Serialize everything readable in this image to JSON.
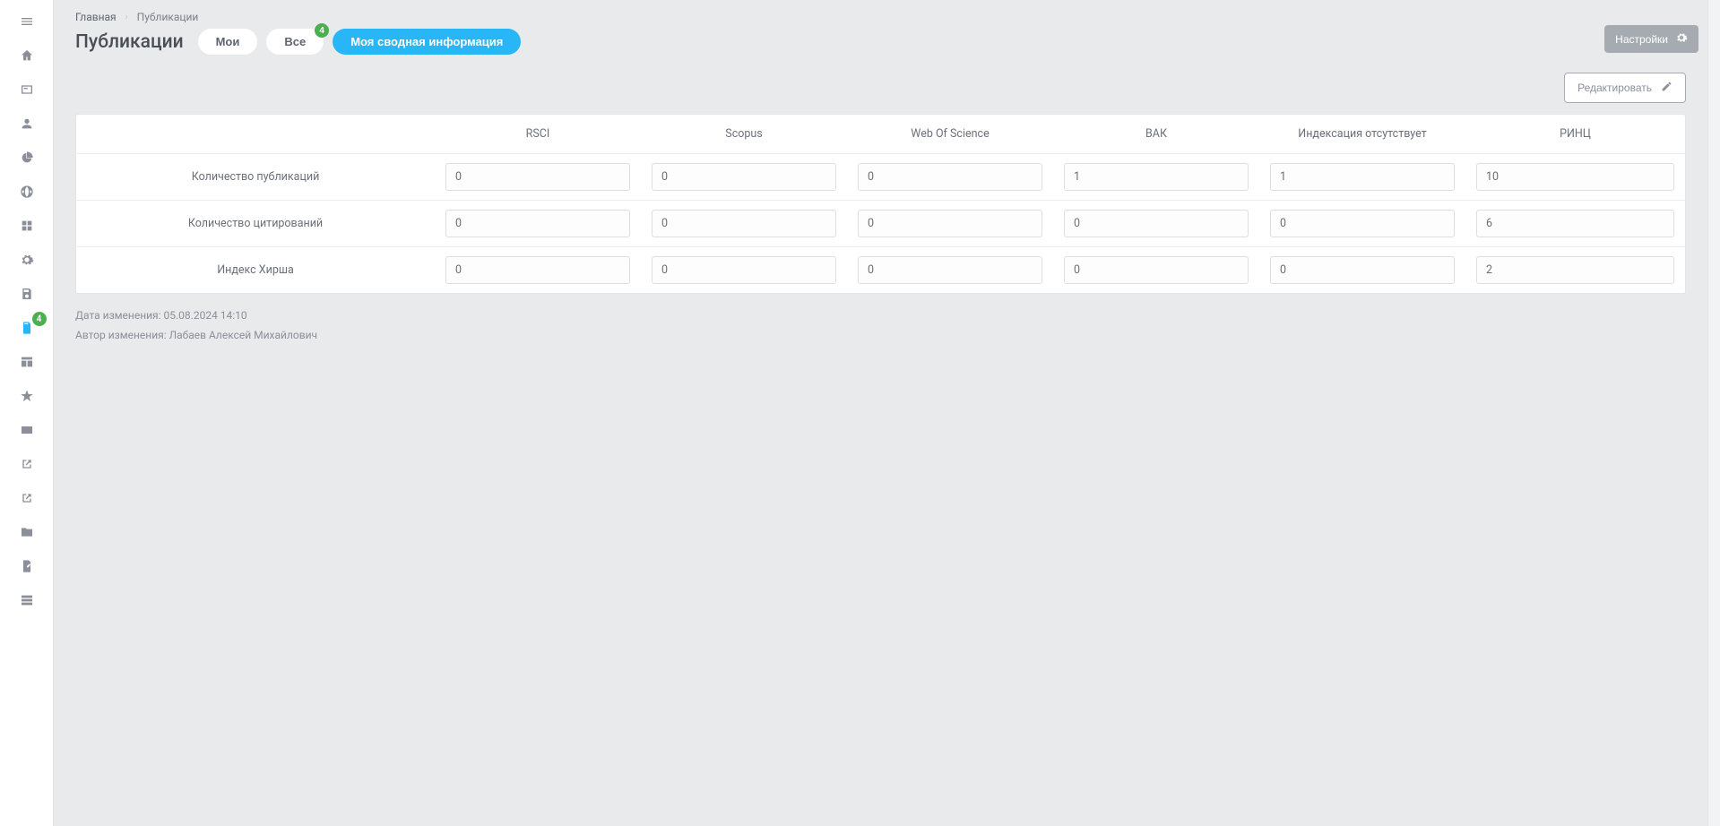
{
  "sidebar": {
    "items": [
      {
        "name": "menu-icon"
      },
      {
        "name": "home-icon"
      },
      {
        "name": "card-icon"
      },
      {
        "name": "user-icon"
      },
      {
        "name": "pie-icon"
      },
      {
        "name": "globe-icon"
      },
      {
        "name": "grid-icon"
      },
      {
        "name": "gear-icon"
      },
      {
        "name": "save-icon"
      },
      {
        "name": "doc-check-icon",
        "badge": "4",
        "active": true
      },
      {
        "name": "table-icon"
      },
      {
        "name": "star-icon"
      },
      {
        "name": "credit-icon"
      },
      {
        "name": "external-icon"
      },
      {
        "name": "external2-icon"
      },
      {
        "name": "folder-icon"
      },
      {
        "name": "draft-icon"
      },
      {
        "name": "th-icon"
      }
    ]
  },
  "breadcrumb": {
    "home": "Главная",
    "current": "Публикации"
  },
  "page_title": "Публикации",
  "tabs": {
    "my": "Мои",
    "all": "Все",
    "all_badge": "4",
    "summary": "Моя сводная информация"
  },
  "buttons": {
    "settings": "Настройки",
    "edit": "Редактировать"
  },
  "table": {
    "columns": [
      "",
      "RSCI",
      "Scopus",
      "Web Of Science",
      "ВАК",
      "Индексация отсутствует",
      "РИНЦ"
    ],
    "rows": [
      {
        "label": "Количество публикаций",
        "values": [
          "0",
          "0",
          "0",
          "1",
          "1",
          "10"
        ]
      },
      {
        "label": "Количество цитирований",
        "values": [
          "0",
          "0",
          "0",
          "0",
          "0",
          "6"
        ]
      },
      {
        "label": "Индекс Хирша",
        "values": [
          "0",
          "0",
          "0",
          "0",
          "0",
          "2"
        ]
      }
    ]
  },
  "meta": {
    "modified_label": "Дата изменения:",
    "modified_value": "05.08.2024 14:10",
    "author_label": "Автор изменения:",
    "author_value": "Лабаев Алексей Михайлович"
  }
}
